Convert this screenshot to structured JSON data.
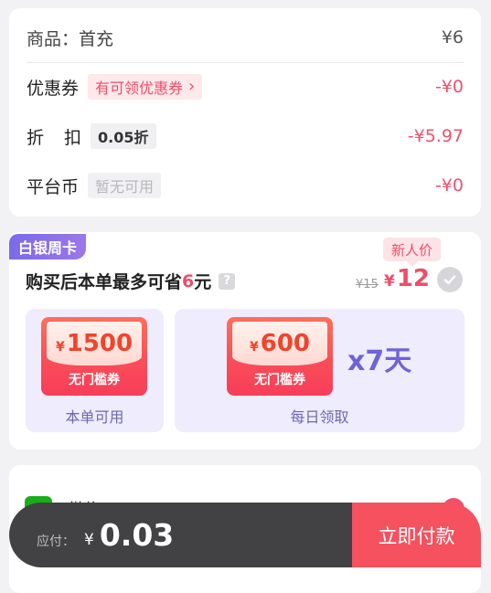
{
  "order": {
    "product_label": "商品：首充",
    "product_price": "¥6",
    "coupon_label": "优惠券",
    "coupon_tag": "有可领优惠券",
    "coupon_value": "-¥0",
    "discount_label": "折扣",
    "discount_tag": "0.05折",
    "discount_value": "-¥5.97",
    "coin_label": "平台币",
    "coin_tag": "暂无可用",
    "coin_value": "-¥0"
  },
  "weekly_card": {
    "badge": "白银周卡",
    "headline_prefix": "购买后本单最多可省",
    "headline_amount": "6",
    "headline_suffix": "元",
    "help_icon": "?",
    "new_user_tag": "新人价",
    "old_price": "¥15",
    "price_yen": "¥",
    "price": "12",
    "benefits": [
      {
        "yen": "¥",
        "amount": "1500",
        "voucher_label": "无门槛券",
        "caption": "本单可用"
      },
      {
        "yen": "¥",
        "amount": "600",
        "voucher_label": "无门槛券",
        "caption": "每日领取",
        "multiplier": "x7天"
      }
    ]
  },
  "payment": {
    "method_label": "微信"
  },
  "bottom_bar": {
    "due_label": "应付：",
    "yen": "¥",
    "amount": "0.03",
    "pay_button": "立即付款"
  },
  "colors": {
    "accent": "#f0506e",
    "badge_purple": "#7b6ae8",
    "bar_dark": "#424244",
    "pay_red": "#f5515f"
  },
  "icons": [
    "chevron-right-icon",
    "help-icon",
    "check-circle-icon",
    "wechat-icon",
    "radio-selected-icon"
  ]
}
